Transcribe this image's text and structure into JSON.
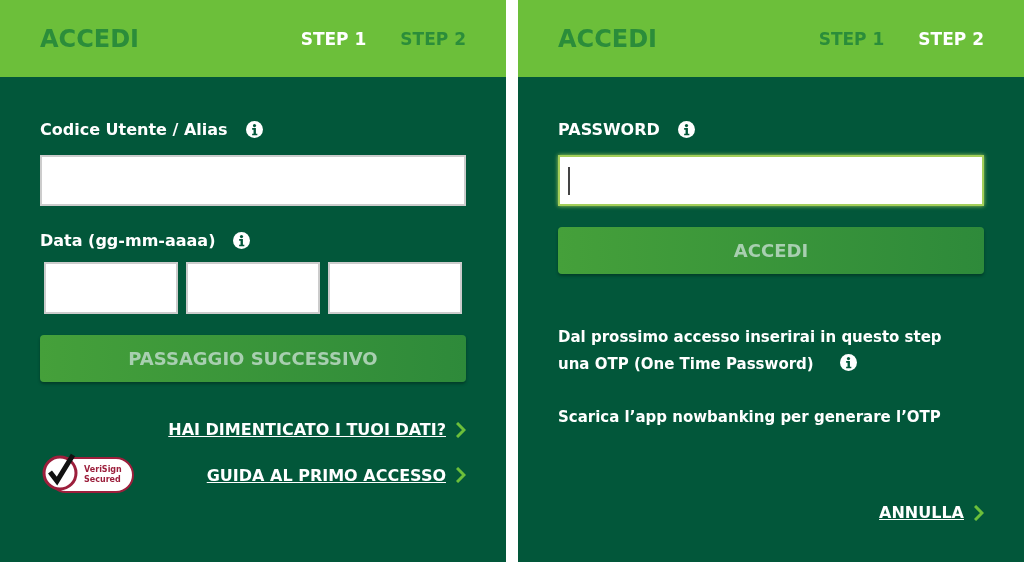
{
  "panels": [
    {
      "title": "ACCEDI",
      "steps": [
        {
          "label": "STEP 1",
          "selected": true
        },
        {
          "label": "STEP 2",
          "selected": false
        }
      ],
      "items": [
        {
          "kind": "label",
          "text": "Codice Utente / Alias",
          "info": true
        },
        {
          "kind": "field",
          "focused": false
        },
        {
          "kind": "label",
          "text": "Data (gg-mm-aaaa)",
          "info": true
        },
        {
          "kind": "date",
          "fields": [
            {
              "focused": false
            },
            {
              "focused": false
            },
            {
              "focused": false
            }
          ]
        },
        {
          "kind": "button",
          "label": "PASSAGGIO SUCCESSIVO",
          "disabled": true
        },
        {
          "kind": "links",
          "links": [
            "HAI DIMENTICATO I TUOI DATI?",
            "GUIDA AL PRIMO ACCESSO"
          ],
          "badge": [
            "VeriSign",
            "Secured"
          ]
        }
      ]
    },
    {
      "title": "ACCEDI",
      "steps": [
        {
          "label": "STEP 1",
          "selected": false
        },
        {
          "label": "STEP 2",
          "selected": true
        }
      ],
      "items": [
        {
          "kind": "label",
          "text": "PASSWORD",
          "info": true
        },
        {
          "kind": "field",
          "focused": true
        },
        {
          "kind": "button",
          "label": "ACCEDI",
          "disabled": true
        },
        {
          "kind": "note",
          "text": "Dal prossimo accesso inserirai in questo step una OTP (One Time Password)",
          "info": true
        },
        {
          "kind": "note",
          "text": "Scarica l’app nowbanking per generare l’OTP",
          "info": false
        },
        {
          "kind": "links",
          "links": [
            "ANNULLA"
          ]
        }
      ]
    }
  ]
}
